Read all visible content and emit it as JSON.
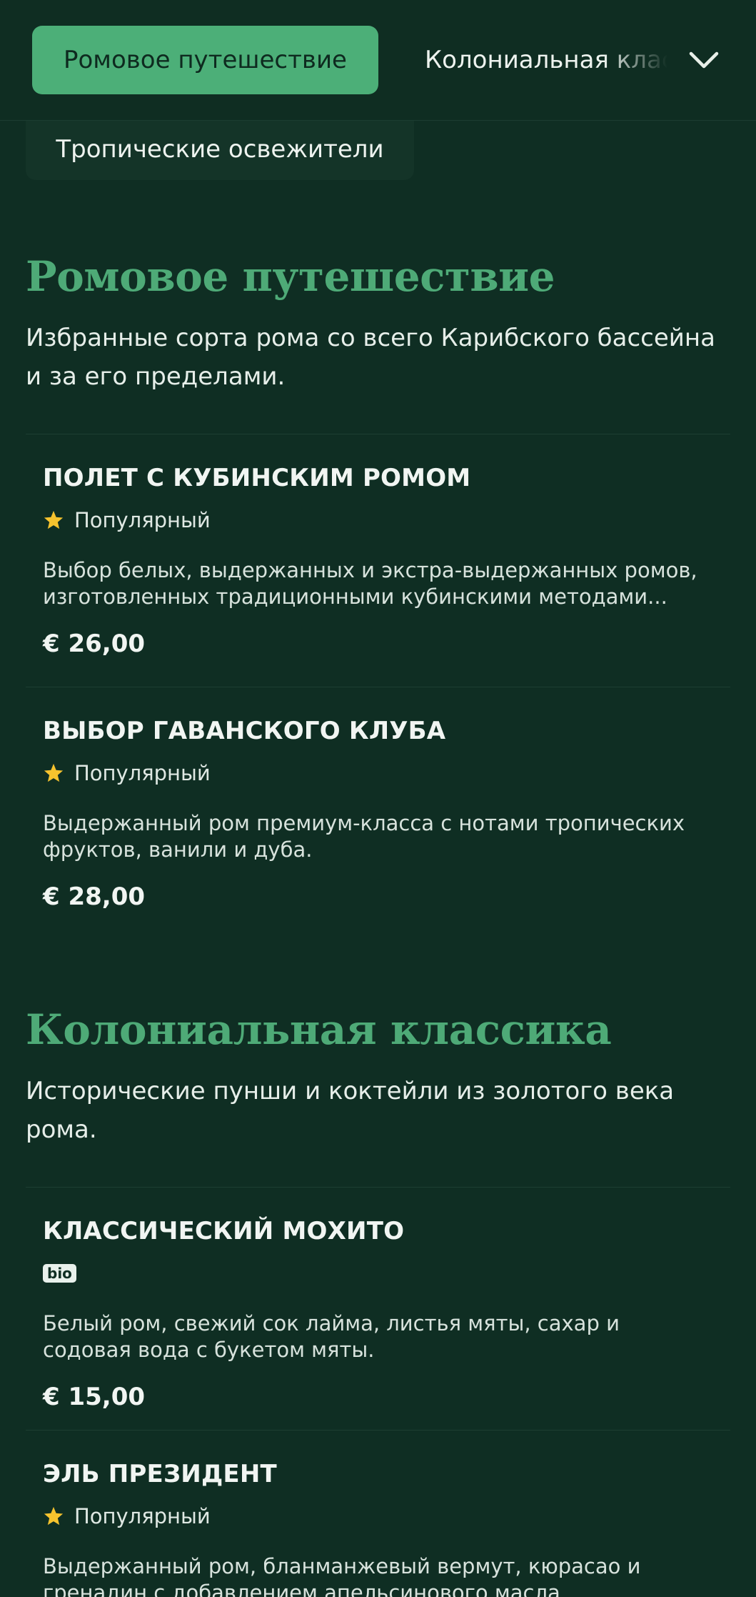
{
  "category_bar": {
    "active": "Ромовое путешествие",
    "next": "Колониальная классика",
    "row2": "Тропические освежители"
  },
  "sections": [
    {
      "title": "Ромовое путешествие",
      "description": "Избранные сорта рома со всего Карибского бассейна и за его пределами.",
      "items": [
        {
          "name": "ПОЛЕТ С КУБИНСКИМ РОМОМ",
          "tag": "Популярный",
          "description": "Выбор белых, выдержанных и экстра-выдержанных ромов, изготовленных традиционными кубинскими методами...",
          "price": "€ 26,00"
        },
        {
          "name": "ВЫБОР ГАВАНСКОГО КЛУБА",
          "tag": "Популярный",
          "description": "Выдержанный ром премиум-класса с нотами тропических фруктов, ванили и дуба.",
          "price": "€ 28,00"
        }
      ]
    },
    {
      "title": "Колониальная классика",
      "description": "Исторические пунши и коктейли из золотого века рома.",
      "items": [
        {
          "name": "КЛАССИЧЕСКИЙ МОХИТО",
          "tag": "bio",
          "description": "Белый ром, свежий сок лайма, листья мяты, сахар и содовая вода с букетом мяты.",
          "price": "€ 15,00"
        },
        {
          "name": "ЭЛЬ ПРЕЗИДЕНТ",
          "tag": "Популярный",
          "description": "Выдержанный ром, бланманжевый вермут, кюрасао и гренадин с добавлением апельсинового масла.",
          "price": ""
        }
      ]
    }
  ],
  "icons": {
    "popular": "star-icon",
    "expand": "chevron-down-icon"
  },
  "colors": {
    "background": "#0f2e23",
    "accent": "#4caf78",
    "star": "#f6c32e"
  }
}
